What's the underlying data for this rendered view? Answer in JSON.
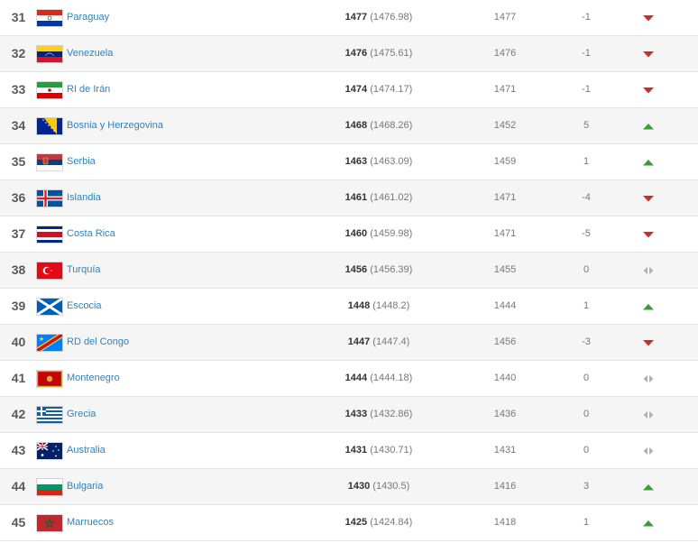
{
  "colors": {
    "link": "#2d82c7",
    "up": "#3e9a3b",
    "down": "#c9302c",
    "same": "#b0b0b0",
    "row_alt": "#f5f5f5"
  },
  "rows": [
    {
      "rank": "31",
      "name": "Paraguay",
      "flag": "paraguay",
      "points": "1477",
      "points_exact": "(1476.98)",
      "previous": "1477",
      "change": "-1",
      "trend": "down"
    },
    {
      "rank": "32",
      "name": "Venezuela",
      "flag": "venezuela",
      "points": "1476",
      "points_exact": "(1475.61)",
      "previous": "1476",
      "change": "-1",
      "trend": "down"
    },
    {
      "rank": "33",
      "name": "RI de Irán",
      "flag": "iran",
      "points": "1474",
      "points_exact": "(1474.17)",
      "previous": "1471",
      "change": "-1",
      "trend": "down"
    },
    {
      "rank": "34",
      "name": "Bosnia y Herzegovina",
      "flag": "bosnia",
      "points": "1468",
      "points_exact": "(1468.26)",
      "previous": "1452",
      "change": "5",
      "trend": "up"
    },
    {
      "rank": "35",
      "name": "Serbia",
      "flag": "serbia",
      "points": "1463",
      "points_exact": "(1463.09)",
      "previous": "1459",
      "change": "1",
      "trend": "up"
    },
    {
      "rank": "36",
      "name": "Islandia",
      "flag": "iceland",
      "points": "1461",
      "points_exact": "(1461.02)",
      "previous": "1471",
      "change": "-4",
      "trend": "down"
    },
    {
      "rank": "37",
      "name": "Costa Rica",
      "flag": "costarica",
      "points": "1460",
      "points_exact": "(1459.98)",
      "previous": "1471",
      "change": "-5",
      "trend": "down"
    },
    {
      "rank": "38",
      "name": "Turquía",
      "flag": "turkey",
      "points": "1456",
      "points_exact": "(1456.39)",
      "previous": "1455",
      "change": "0",
      "trend": "same"
    },
    {
      "rank": "39",
      "name": "Escocia",
      "flag": "scotland",
      "points": "1448",
      "points_exact": "(1448.2)",
      "previous": "1444",
      "change": "1",
      "trend": "up"
    },
    {
      "rank": "40",
      "name": "RD del Congo",
      "flag": "drcongo",
      "points": "1447",
      "points_exact": "(1447.4)",
      "previous": "1456",
      "change": "-3",
      "trend": "down"
    },
    {
      "rank": "41",
      "name": "Montenegro",
      "flag": "montenegro",
      "points": "1444",
      "points_exact": "(1444.18)",
      "previous": "1440",
      "change": "0",
      "trend": "same"
    },
    {
      "rank": "42",
      "name": "Grecia",
      "flag": "greece",
      "points": "1433",
      "points_exact": "(1432.86)",
      "previous": "1436",
      "change": "0",
      "trend": "same"
    },
    {
      "rank": "43",
      "name": "Australia",
      "flag": "australia",
      "points": "1431",
      "points_exact": "(1430.71)",
      "previous": "1431",
      "change": "0",
      "trend": "same"
    },
    {
      "rank": "44",
      "name": "Bulgaria",
      "flag": "bulgaria",
      "points": "1430",
      "points_exact": "(1430.5)",
      "previous": "1416",
      "change": "3",
      "trend": "up"
    },
    {
      "rank": "45",
      "name": "Marruecos",
      "flag": "morocco",
      "points": "1425",
      "points_exact": "(1424.84)",
      "previous": "1418",
      "change": "1",
      "trend": "up"
    }
  ]
}
